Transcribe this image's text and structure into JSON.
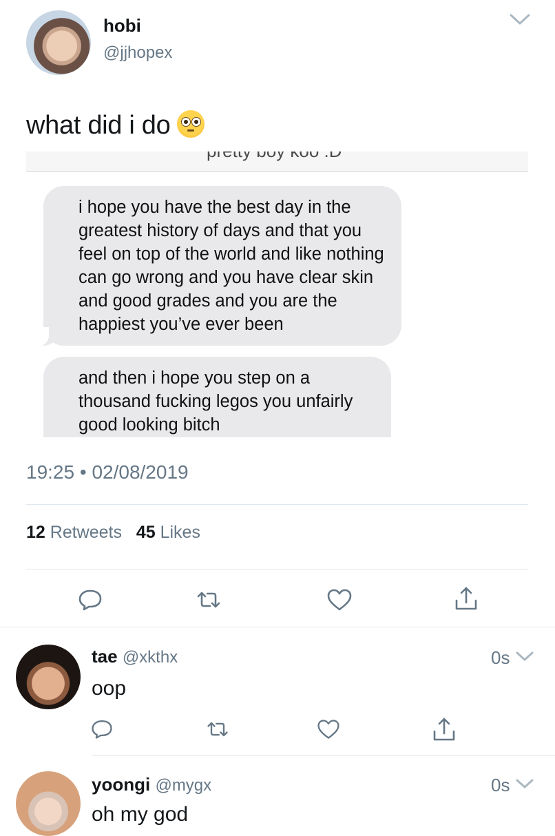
{
  "tweet": {
    "author_name": "hobi",
    "author_handle": "@jjhopex",
    "text": "what did i do",
    "emoji": "flushed-face",
    "screenshot": {
      "cut_text": "pretty boy koo :D",
      "message_1": "i hope you have the best day in the greatest history of days and that you feel on top of the world and like nothing can go wrong and you have clear skin and good grades and you are the happiest you’ve ever been",
      "message_2": "and then i hope you step on a thousand fucking legos you unfairly good looking bitch"
    },
    "time": "19:25",
    "separator": "•",
    "date": "02/08/2019",
    "retweet_count": "12",
    "retweet_label": "Retweets",
    "like_count": "45",
    "like_label": "Likes"
  },
  "replies": [
    {
      "name": "tae",
      "handle": "@xkthx",
      "time": "0s",
      "text": "oop"
    },
    {
      "name": "yoongi",
      "handle": "@mygx",
      "time": "0s",
      "text": "oh my god"
    }
  ],
  "colors": {
    "text": "#14171a",
    "muted": "#657786",
    "divider": "#e1e8ed",
    "bubble": "#e9e9ec"
  },
  "icons": [
    "chevron-down-icon",
    "reply-icon",
    "retweet-icon",
    "like-icon",
    "share-icon"
  ]
}
